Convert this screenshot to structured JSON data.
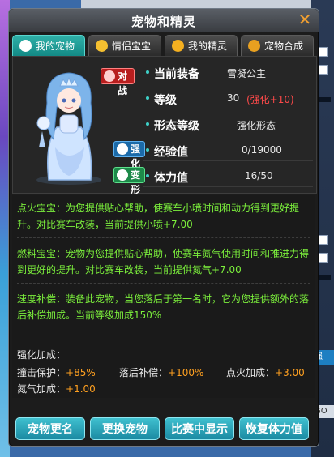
{
  "window": {
    "title": "宠物和精灵",
    "close_glyph": "✕"
  },
  "tabs": [
    {
      "label": "我的宠物",
      "icon": "pet-icon",
      "active": true
    },
    {
      "label": "情侣宝宝",
      "icon": "couple-baby-icon",
      "active": false
    },
    {
      "label": "我的精灵",
      "icon": "sprite-icon",
      "active": false
    },
    {
      "label": "宠物合成",
      "icon": "pet-merge-icon",
      "active": false
    }
  ],
  "badges": {
    "battle": "对战",
    "strong": "强化",
    "morph": "变形"
  },
  "stats": [
    {
      "key": "当前装备",
      "value": "雪凝公主"
    },
    {
      "key": "等级",
      "value": "30",
      "extra": "(强化+10)"
    },
    {
      "key": "形态等级",
      "value": "强化形态"
    },
    {
      "key": "经验值",
      "value": "0/19000"
    },
    {
      "key": "体力值",
      "value": "16/50"
    }
  ],
  "descriptions": [
    "点火宝宝：为您提供贴心帮助，使赛车小喷时间和动力得到更好提升。对比赛车改装，当前提供小喷+7.00",
    "燃料宝宝：宠物为您提供贴心帮助，使赛车氮气使用时间和推进力得到更好的提升。对比赛车改装，当前提供氮气+7.00",
    "速度补偿：装备此宠物，当您落后于第一名时，它为您提供额外的落后补偿加成。当前等级加成150%"
  ],
  "bonus": {
    "title": "强化加成：",
    "items": [
      {
        "label": "撞击保护：",
        "value": "+85%"
      },
      {
        "label": "落后补偿：",
        "value": "+100%"
      },
      {
        "label": "点火加成：",
        "value": "+3.00"
      },
      {
        "label": "氮气加成：",
        "value": "+1.00"
      }
    ]
  },
  "buttons": {
    "rename": "宠物更名",
    "change": "更换宠物",
    "show_in_race": "比赛中显示",
    "restore_stamina": "恢复体力值"
  },
  "background": {
    "tag_label": "强",
    "go_label": "GO"
  },
  "colors": {
    "accent": "#2fb0a8",
    "green_text": "#7cf03c",
    "red_text": "#ff4a4a",
    "orange": "#ffa020"
  }
}
